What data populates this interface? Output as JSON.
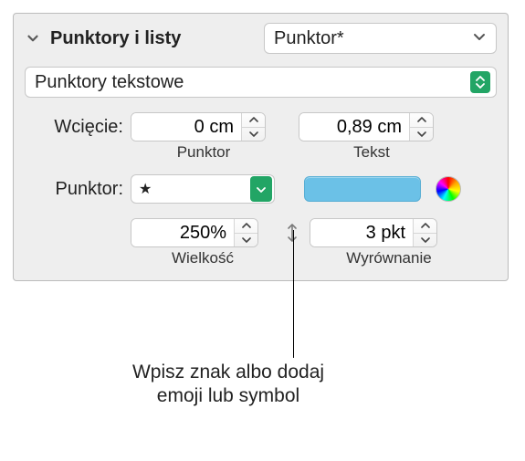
{
  "header": {
    "title": "Punktory i listy",
    "style_select": "Punktor*"
  },
  "type_select": "Punktory tekstowe",
  "indent": {
    "label": "Wcięcie:",
    "bullet_value": "0 cm",
    "bullet_sublabel": "Punktor",
    "text_value": "0,89 cm",
    "text_sublabel": "Tekst"
  },
  "bullet": {
    "label": "Punktor:",
    "symbol": "★",
    "color": "#6bc1e7"
  },
  "size": {
    "value": "250%",
    "sublabel": "Wielkość",
    "align_value": "3 pkt",
    "align_sublabel": "Wyrównanie"
  },
  "callout": {
    "line1": "Wpisz znak albo dodaj",
    "line2": "emoji lub symbol"
  }
}
